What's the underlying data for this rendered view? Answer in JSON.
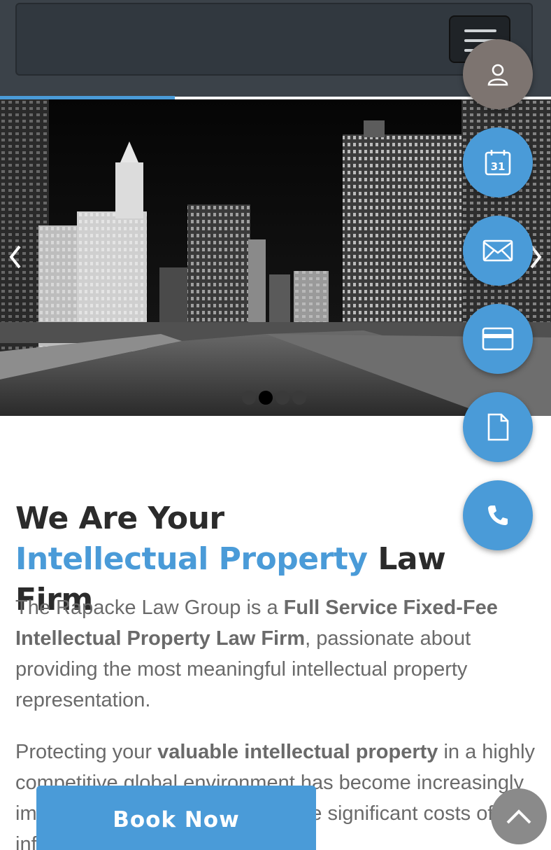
{
  "header": {
    "menu_icon": "hamburger-icon"
  },
  "slider": {
    "slide_count": 4,
    "active_slide": 2,
    "image_description_icon": "city-skyline-image",
    "prev_icon": "chevron-left-icon",
    "next_icon": "chevron-right-icon"
  },
  "fabs": [
    {
      "name": "user-icon"
    },
    {
      "name": "calendar-icon",
      "date_text": "31"
    },
    {
      "name": "envelope-icon"
    },
    {
      "name": "credit-card-icon"
    },
    {
      "name": "document-icon"
    },
    {
      "name": "phone-icon"
    }
  ],
  "content": {
    "headline_line1": "We Are Your",
    "headline_accent": "Intellectual Property",
    "headline_line2_rest": " Law Firm",
    "p1_a": "The Rapacke Law Group is a ",
    "p1_bold": "Full Service Fixed-Fee Intellectual Property Law Firm",
    "p1_b": ", passionate about providing the most meaningful intellectual property representation.",
    "p2_a": "Protecting your ",
    "p2_bold": "valuable intellectual property",
    "p2_b": " in a highly competitive global environment has become increasingly important for businesses. With the significant costs of infringement and damages"
  },
  "book_now_label": "Book Now",
  "colors": {
    "accent": "#4a9bd8",
    "header": "#3b4249",
    "user_fab": "#7d7470"
  }
}
